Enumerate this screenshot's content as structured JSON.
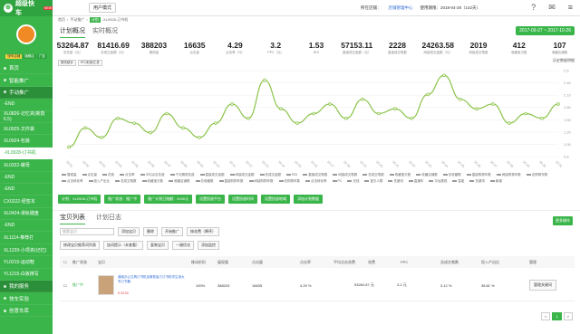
{
  "app": {
    "title": "超级快车",
    "badge": "NEW",
    "mode_button": "用户模式"
  },
  "user": {
    "name": "",
    "tags": [
      "快车店铺",
      "旗舰店",
      "广告"
    ]
  },
  "sidebar": {
    "items": [
      {
        "label": "首页"
      },
      {
        "label": "智能推广"
      },
      {
        "label": "手动推广"
      },
      {
        "label": "-END"
      },
      {
        "label": "XL0826-记忆夹(新款6.5)"
      },
      {
        "label": "XL0925-文件袋"
      },
      {
        "label": "XL0924-包装"
      },
      {
        "label": "-XL0928-订书机"
      },
      {
        "label": "XL0322-螺母"
      },
      {
        "label": "-END"
      },
      {
        "label": "-END"
      },
      {
        "label": "CX0222-便签本"
      },
      {
        "label": "XL0424-滑轨键盘"
      },
      {
        "label": "-END"
      },
      {
        "label": "XL1114-推荐打"
      },
      {
        "label": "XL1220-小项夹(记忆)"
      },
      {
        "label": "YL0215-运动鞋"
      },
      {
        "label": "YL1215-白板擦写"
      },
      {
        "label": "我的服务"
      },
      {
        "label": "快车实验"
      },
      {
        "label": "创意车库"
      }
    ]
  },
  "topbar": {
    "platform": "所在店铺：",
    "shop_link": "店铺管理中心",
    "expire": "使用期限：2018-04-28（142天）"
  },
  "breadcrumb": [
    "首页",
    "手动推广",
    "计划",
    "-XL0928-订书机"
  ],
  "tabs": [
    {
      "label": "计划概况"
    },
    {
      "label": "实时概况"
    }
  ],
  "date_range": "2017-09-27 ~ 2017-10-26",
  "metrics": [
    {
      "value": "53264.87",
      "label": "总花费（元）"
    },
    {
      "value": "81416.69",
      "label": "总成交金额（元）"
    },
    {
      "value": "388203",
      "label": "展现量"
    },
    {
      "value": "16635",
      "label": "点击量"
    },
    {
      "value": "4.29",
      "label": "点击率（%）"
    },
    {
      "value": "3.2",
      "label": "PPC（元）"
    },
    {
      "value": "1.53",
      "label": "ROI"
    },
    {
      "value": "57153.11",
      "label": "直接成交金额（元）"
    },
    {
      "value": "2228",
      "label": "直接成交笔数"
    },
    {
      "value": "24263.58",
      "label": "间接成交金额（元）"
    },
    {
      "value": "2019",
      "label": "间接成交笔数"
    },
    {
      "value": "412",
      "label": "收藏宝贝数"
    },
    {
      "value": "107",
      "label": "收藏店铺数"
    }
  ],
  "chart_filters": [
    "按天统计",
    "PC/无线/汇总"
  ],
  "chart_link": "历史数据明细",
  "chart_data": {
    "type": "line",
    "x": [
      "10-01",
      "10-02",
      "10-03",
      "10-04",
      "10-05",
      "10-06",
      "10-07",
      "10-08",
      "10-09",
      "10-10",
      "10-11",
      "10-12",
      "10-13",
      "10-14",
      "10-15",
      "10-16",
      "10-17",
      "10-18",
      "10-19",
      "10-20",
      "10-21",
      "10-22",
      "10-23",
      "10-24",
      "10-25",
      "10-26",
      "10-27",
      "10-28",
      "10-29",
      "10-30",
      "10-31"
    ],
    "series": [
      {
        "name": "ROI",
        "color": "#8bc34a",
        "values": [
          1.0,
          1.4,
          1.2,
          1.6,
          1.5,
          1.3,
          1.7,
          1.4,
          1.2,
          1.5,
          1.9,
          1.6,
          2.4,
          1.8,
          1.5,
          1.7,
          1.9,
          1.6,
          2.0,
          1.7,
          1.8,
          1.6,
          2.1,
          2.5,
          2.0,
          1.8,
          1.9,
          1.5,
          1.7,
          1.6,
          1.9
        ]
      }
    ],
    "ylim": [
      0.8,
      2.6
    ],
    "y_ticks": [
      "2.6",
      "2.40",
      "2.10",
      "1.80",
      "1.50",
      "1.20",
      "1.00",
      "0.8"
    ],
    "grid": true
  },
  "legend": [
    "展现量",
    "点击量",
    "花费",
    "点击率",
    "平均点击花费",
    "千次展现花费",
    "直接成交金额",
    "间接成交金额",
    "总成交金额",
    "ROI",
    "直接成交笔数",
    "间接成交笔数",
    "总成交笔数",
    "收藏宝贝数",
    "收藏店铺数",
    "总收藏数",
    "直接购物车数",
    "间接购物车数",
    "总购物车数",
    "点击转化率",
    "投入产出比",
    "总成交笔数",
    "收藏宝贝数",
    "收藏店铺数",
    "总收藏数",
    "直接购物车数",
    "间接购物车数",
    "总购物车数",
    "点击转化率",
    "PC",
    "无线",
    "宝贝人群",
    "关键词",
    "直通车",
    "平台展现",
    "智能",
    "关键词",
    "新增"
  ],
  "actions": [
    "计划：XL0928-订书机",
    "推广状态：推广中",
    "推广计划日限额：2000元",
    "设置投放平台",
    "设置投放时间",
    "设置投放地域",
    "添加计划数据"
  ],
  "list": {
    "tabs": [
      {
        "label": "宝贝列表"
      },
      {
        "label": "计划日志"
      }
    ],
    "batch_button": "更多操作",
    "search_placeholder": "搜索宝贝",
    "toolbar1": [
      "添加宝贝",
      "删除",
      "开始推广",
      "按花费（降序）"
    ],
    "toolbar2": [
      "修改宝贝推荐词列表",
      "加词提示（未查看）",
      "复制宝贝",
      "一键优化",
      "添加监控"
    ],
    "headers": [
      "推广状态",
      "宝贝",
      "移动折扣",
      "展现量",
      "点击量",
      "点击率",
      "平均点击花费",
      "花费",
      "PPC",
      "总成交笔数",
      "投入产出比",
      "管理"
    ],
    "rows": [
      {
        "status": "推广中",
        "title": "通用办公文具订书机加厚型省力订书机学生用大号订书器",
        "price": "¥ 33.00",
        "discount": "100%",
        "impressions": "388203",
        "clicks": "16635",
        "ctr": "4.29 %",
        "cost": "53264.87 元",
        "ppc": "3.2 元",
        "conv": "3.12 %",
        "roi": "38.81 %",
        "manage": "管理关键词"
      }
    ],
    "pager": [
      "<",
      "1",
      ">"
    ]
  }
}
